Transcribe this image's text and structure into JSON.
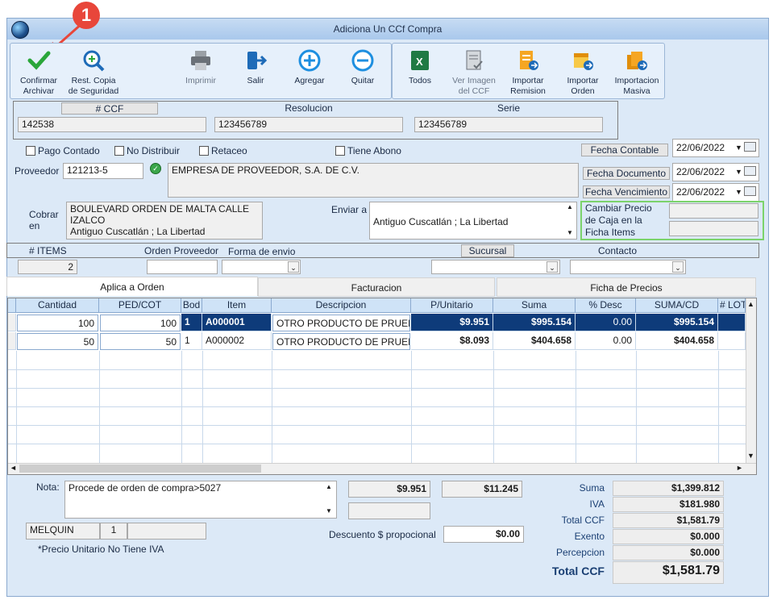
{
  "window": {
    "title": "Adiciona Un CCf Compra"
  },
  "annotation": {
    "badge": "1"
  },
  "toolbar": {
    "confirmar": "Confirmar\nArchivar",
    "rest_copia": "Rest. Copia\nde Seguridad",
    "imprimir": "Imprimir",
    "salir": "Salir",
    "agregar": "Agregar",
    "quitar": "Quitar",
    "todos": "Todos",
    "ver_imagen": "Ver Imagen\ndel CCF",
    "importar_remision": "Importar\nRemision",
    "importar_orden": "Importar\nOrden",
    "importacion_masiva": "Importacion\nMasiva"
  },
  "header": {
    "ccf_label": "# CCF",
    "ccf_value": "142538",
    "resolucion_label": "Resolucion",
    "resolucion_value": "123456789",
    "serie_label": "Serie",
    "serie_value": "123456789"
  },
  "checks": {
    "pago_contado": "Pago Contado",
    "no_distribuir": "No Distribuir",
    "retaceo": "Retaceo",
    "tiene_abono": "Tiene Abono"
  },
  "dates": {
    "fecha_contable_label": "Fecha Contable",
    "fecha_contable": "22/06/2022",
    "fecha_documento_label": "Fecha Documento",
    "fecha_documento": "22/06/2022",
    "fecha_vencimiento_label": "Fecha Vencimiento",
    "fecha_vencimiento": "22/06/2022"
  },
  "proveedor": {
    "label": "Proveedor",
    "code": "121213-5",
    "name": "EMPRESA DE PROVEEDOR, S.A. DE C.V."
  },
  "cobrar": {
    "label": "Cobrar\nen",
    "value": "BOULEVARD ORDEN DE MALTA CALLE\nIZALCO\nAntiguo Cuscatlán ; La Libertad"
  },
  "enviar": {
    "label": "Enviar a",
    "value": "Antiguo Cuscatlán ; La Libertad"
  },
  "cambiar_precio": "Cambiar Precio\nde Caja en la\nFicha Items",
  "info": {
    "items_label": "# ITEMS",
    "items_value": "2",
    "orden_proveedor_label": "Orden Proveedor",
    "forma_envio_label": "Forma de envio",
    "sucursal_label": "Sucursal",
    "contacto_label": "Contacto"
  },
  "tabs": [
    "Aplica a Orden",
    "Facturacion",
    "Ficha de Precios"
  ],
  "grid": {
    "columns": [
      "Cantidad",
      "PED/COT",
      "Bod",
      "Item",
      "Descripcion",
      "P/Unitario",
      "Suma",
      "% Desc",
      "SUMA/CD",
      "# LOT"
    ],
    "rows": [
      [
        "100",
        "100",
        "1",
        "A000001",
        "OTRO PRODUCTO DE PRUEBA",
        "$9.951",
        "$995.154",
        "0.00",
        "$995.154",
        ""
      ],
      [
        "50",
        "50",
        "1",
        "A000002",
        "OTRO PRODUCTO DE PRUEBA",
        "$8.093",
        "$404.658",
        "0.00",
        "$404.658",
        ""
      ]
    ]
  },
  "footer": {
    "nota_label": "Nota:",
    "nota_value": "Procede de orden de compra>5027",
    "price1": "$9.951",
    "price2": "$11.245",
    "user": "MELQUIN",
    "user_num": "1",
    "descuento_label": "Descuento $ propocional",
    "descuento_value": "$0.00",
    "note_iva": "*Precio Unitario No Tiene IVA"
  },
  "totals": {
    "suma_label": "Suma",
    "suma": "$1,399.812",
    "iva_label": "IVA",
    "iva": "$181.980",
    "total_ccf_label": "Total CCF",
    "total_ccf": "$1,581.79",
    "exento_label": "Exento",
    "exento": "$0.000",
    "percepcion_label": "Percepcion",
    "percepcion": "$0.000",
    "grand_label": "Total CCF",
    "grand": "$1,581.79"
  },
  "colors": {
    "accent": "#0e3b7a",
    "window_bg": "#dce9f7",
    "badge": "#e8463a",
    "green_border": "#7bd36b"
  }
}
